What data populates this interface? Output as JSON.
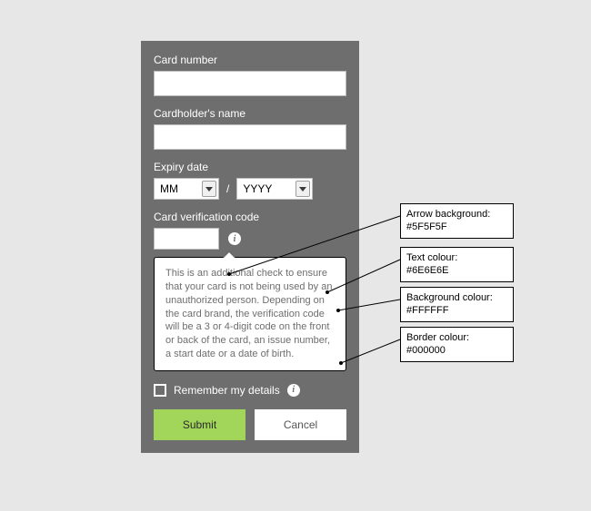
{
  "form": {
    "cardNumber": {
      "label": "Card number"
    },
    "cardholderName": {
      "label": "Cardholder's name"
    },
    "expiry": {
      "label": "Expiry date",
      "monthPlaceholder": "MM",
      "yearPlaceholder": "YYYY",
      "separator": "/"
    },
    "cvv": {
      "label": "Card verification code",
      "infoGlyph": "i",
      "tooltip": "This is an additional check to ensure that your card is not being used by an unauthorized person. Depending on the card brand, the verification code will be a 3 or 4-digit code on the front or back of the card, an issue number, a start date or a date of birth."
    },
    "remember": {
      "label": "Remember my details",
      "infoGlyph": "i"
    },
    "buttons": {
      "submit": "Submit",
      "cancel": "Cancel"
    }
  },
  "annotations": {
    "arrowBg": {
      "label": "Arrow background:",
      "value": "#5F5F5F"
    },
    "textColour": {
      "label": "Text colour:",
      "value": "#6E6E6E"
    },
    "bgColour": {
      "label": "Background colour:",
      "value": "#FFFFFF"
    },
    "borderColour": {
      "label": "Border colour:",
      "value": "#000000"
    }
  }
}
